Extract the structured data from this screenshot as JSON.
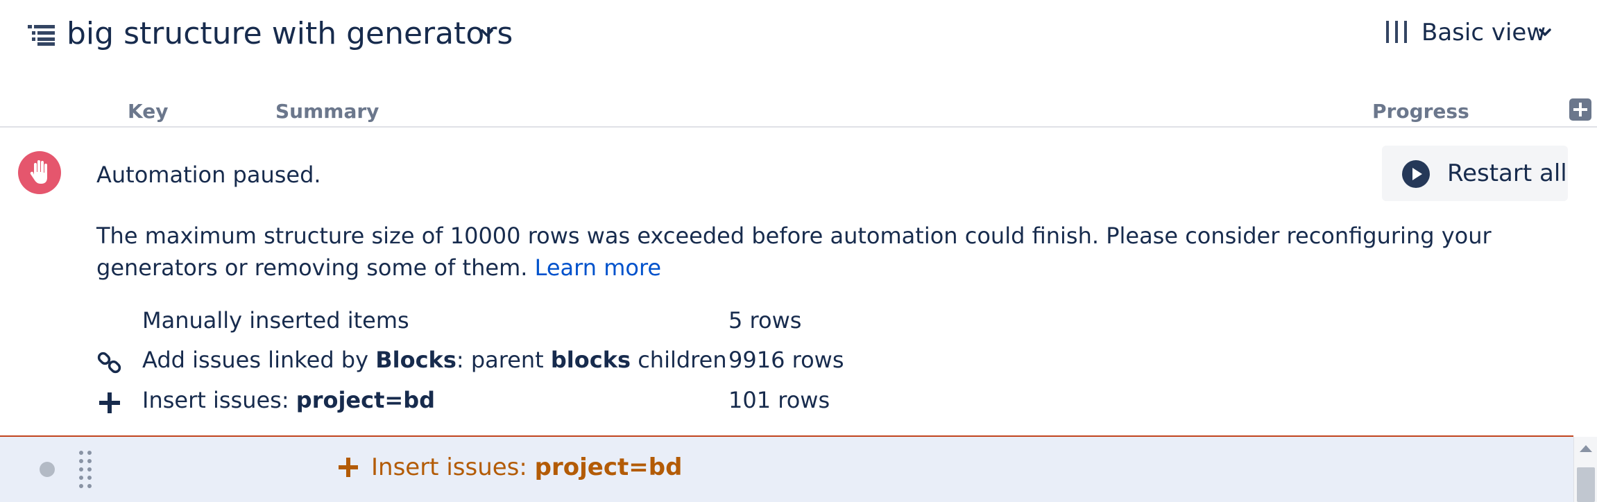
{
  "header": {
    "title": "big structure with generators",
    "view_label": "Basic view",
    "icons": {
      "structure": "structure-list-icon",
      "title_dropdown": "chevron-down-icon",
      "view": "columns-icon",
      "view_dropdown": "chevron-down-icon"
    }
  },
  "columns": {
    "key": "Key",
    "summary": "Summary",
    "progress": "Progress",
    "add_column_icon": "plus-square-icon"
  },
  "notice": {
    "title": "Automation paused.",
    "icon": "stop-hand-icon",
    "restart_label": "Restart all",
    "restart_icon": "play-circle-icon",
    "message": "The maximum structure size of 10000 rows was exceeded before automation could finish. Please consider reconfiguring your generators or removing some of them.",
    "learn_more": "Learn more"
  },
  "generators": [
    {
      "icon": "",
      "label_plain": "Manually inserted items",
      "count": "5 rows"
    },
    {
      "icon": "link-icon",
      "label_prefix": "Add issues linked by ",
      "link_type": "Blocks",
      "label_middle": ": parent ",
      "direction": "blocks",
      "label_suffix": " children",
      "count": "9916 rows"
    },
    {
      "icon": "plus-icon",
      "label_prefix": "Insert issues: ",
      "query": "project=bd",
      "count": "101 rows"
    }
  ],
  "selected_row": {
    "label_prefix": "Insert issues: ",
    "query": "project=bd",
    "icon": "plus-icon"
  },
  "colors": {
    "text": "#172b4d",
    "muted": "#6b778c",
    "link": "#0052cc",
    "stop": "#e5566d",
    "generator": "#b35b06",
    "selected_bg": "#e9eef8",
    "selected_border": "#c1441e"
  }
}
